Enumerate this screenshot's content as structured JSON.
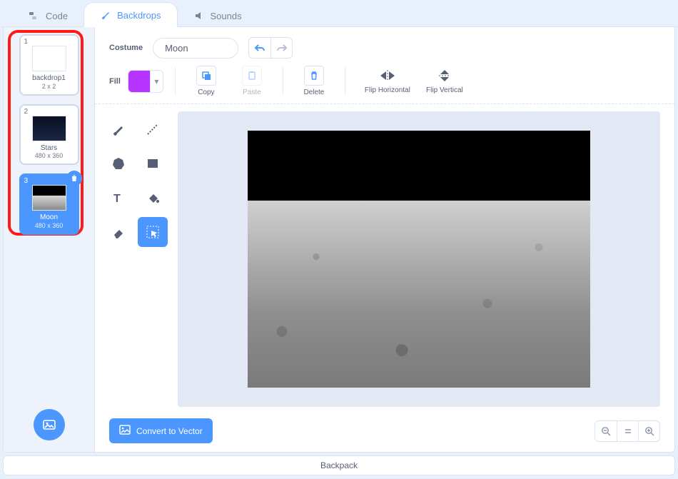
{
  "tabs": {
    "code": "Code",
    "backdrops": "Backdrops",
    "sounds": "Sounds",
    "active": "backdrops"
  },
  "sidebar": {
    "items": [
      {
        "num": "1",
        "name": "backdrop1",
        "dim": "2 x 2"
      },
      {
        "num": "2",
        "name": "Stars",
        "dim": "480 x 360"
      },
      {
        "num": "3",
        "name": "Moon",
        "dim": "480 x 360"
      }
    ],
    "selected_index": 2
  },
  "editor": {
    "costume_label": "Costume",
    "costume_name": "Moon",
    "fill_label": "Fill",
    "fill_color": "#b733ff",
    "buttons": {
      "copy": "Copy",
      "paste": "Paste",
      "delete": "Delete",
      "flip_h": "Flip Horizontal",
      "flip_v": "Flip Vertical"
    },
    "tools": {
      "brush": "brush",
      "line": "line",
      "circle": "circle",
      "rect": "rect",
      "text": "text",
      "fill": "fill",
      "eraser": "eraser",
      "select": "select",
      "active": "select"
    },
    "convert": "Convert to Vector"
  },
  "backpack": "Backpack"
}
